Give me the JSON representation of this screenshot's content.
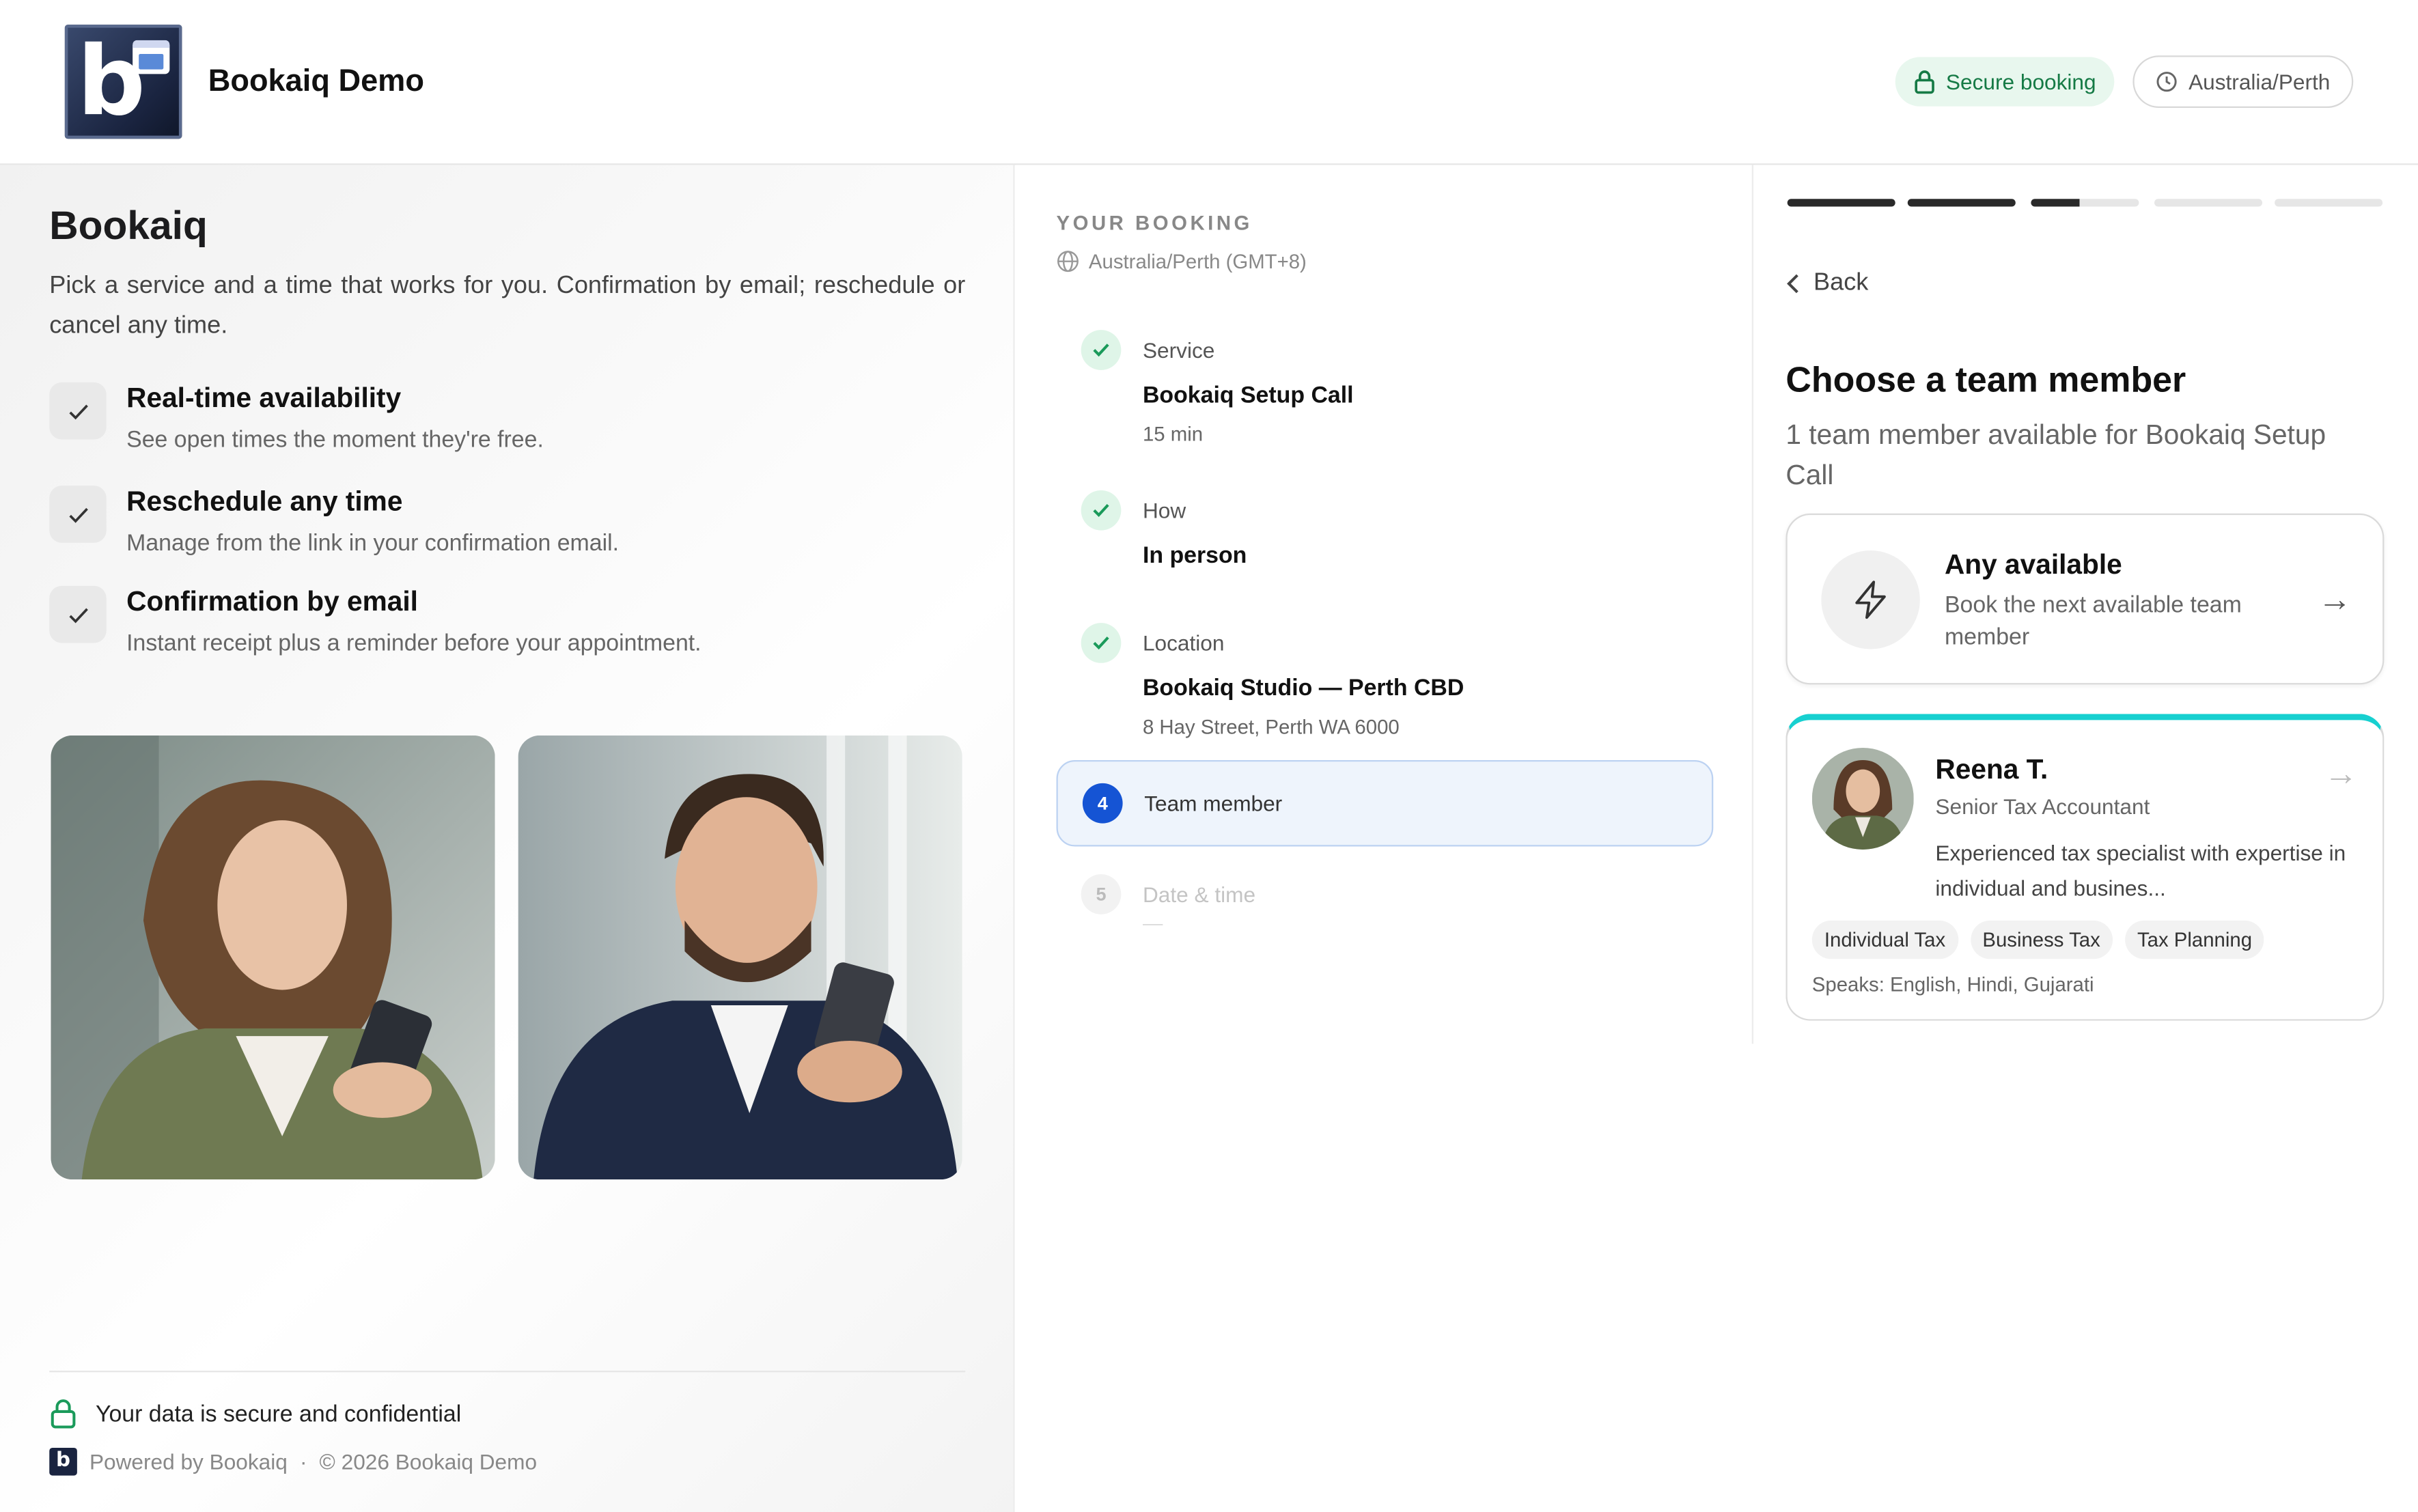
{
  "header": {
    "brand": "Bookaiq Demo",
    "secure_label": "Secure booking",
    "timezone": "Australia/Perth"
  },
  "left": {
    "title": "Bookaiq",
    "intro": "Pick a service and a time that works for you. Confirmation by email; reschedule or cancel any time.",
    "features": [
      {
        "title": "Real-time availability",
        "desc": "See open times the moment they're free."
      },
      {
        "title": "Reschedule any time",
        "desc": "Manage from the link in your confirmation email."
      },
      {
        "title": "Confirmation by email",
        "desc": "Instant receipt plus a reminder before your appointment."
      }
    ],
    "secure_note": "Your data is secure and confidential",
    "powered": "Powered by Bookaiq",
    "sep": "·",
    "copyright": "© 2026 Bookaiq Demo"
  },
  "summary": {
    "heading": "YOUR BOOKING",
    "timezone": "Australia/Perth (GMT+8)",
    "steps": [
      {
        "num": "1",
        "label": "Service",
        "value": "Bookaiq Setup Call",
        "sub": "15 min",
        "state": "done"
      },
      {
        "num": "2",
        "label": "How",
        "value": "In person",
        "sub": "",
        "state": "done"
      },
      {
        "num": "3",
        "label": "Location",
        "value": "Bookaiq Studio — Perth CBD",
        "sub": "8 Hay Street, Perth WA 6000",
        "state": "done"
      },
      {
        "num": "4",
        "label": "Team member",
        "value": "",
        "sub": "",
        "state": "current"
      },
      {
        "num": "5",
        "label": "Date & time",
        "value": "",
        "sub": "—",
        "state": "future"
      }
    ]
  },
  "panel": {
    "progress_steps_done": 2.5,
    "progress_steps_total": 5,
    "back_label": "Back",
    "title": "Choose a team member",
    "subtitle": "1 team member available for Bookaiq Setup Call",
    "any": {
      "title": "Any available",
      "desc": "Book the next available team member",
      "arrow": "→"
    },
    "member": {
      "name": "Reena T.",
      "role": "Senior Tax Accountant",
      "desc": "Experienced tax specialist with expertise in individual and busines...",
      "arrow": "→",
      "tags": [
        "Individual Tax",
        "Business Tax",
        "Tax Planning"
      ],
      "languages": "Speaks: English, Hindi, Gujarati"
    }
  },
  "colors": {
    "accent": "#1554d4",
    "success": "#1a9a5a",
    "highlight": "#17d0d0",
    "current_bg": "#eef4fc"
  }
}
